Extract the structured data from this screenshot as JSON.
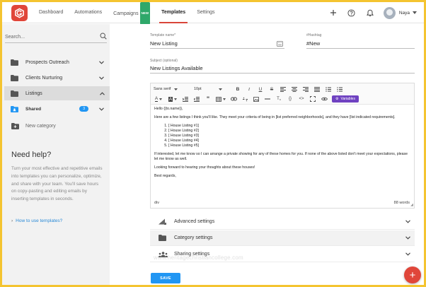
{
  "nav": {
    "items": [
      {
        "label": "Dashboard",
        "active": false
      },
      {
        "label": "Automations",
        "active": false
      },
      {
        "label": "Campaigns",
        "active": false,
        "badge": "NEW"
      },
      {
        "label": "Templates",
        "active": true
      },
      {
        "label": "Settings",
        "active": false
      }
    ],
    "user_name": "Naya",
    "icons": [
      "plus-icon",
      "help-icon",
      "bell-icon",
      "avatar",
      "caret-down-icon"
    ]
  },
  "sidebar": {
    "search_placeholder": "Search...",
    "folders": [
      {
        "label": "Prospects Outreach",
        "active": false
      },
      {
        "label": "Clients Nurturing",
        "active": false
      },
      {
        "label": "Listings",
        "active": true
      },
      {
        "label": "Shared",
        "count": "3",
        "active": false
      }
    ],
    "new_category": "New category",
    "help": {
      "title": "Need help?",
      "text": "Turn your most effective and repetitive emails into templates you can personalize, optimize, and share with your team. You'll save hours on copy-pasting and editing emails by inserting templates in seconds.",
      "link": "How to use templates?"
    }
  },
  "form": {
    "template_name_label": "Template name*",
    "template_name_value": "New Listing",
    "hashtag_label": "#Hashtag",
    "hashtag_value": "#New",
    "subject_label": "Subject (optional)",
    "subject_value": "New Listings Available"
  },
  "editor": {
    "font_family": "Sans serif",
    "font_size": "10pt",
    "variables_label": "Variables",
    "greeting": "Hello {{to.name}},",
    "intro": "Here are a few listings I think you'll like. They meet your criteria of being in [list preferred neighborhoods], and they have [list indicated requirements].",
    "listings": [
      "[ House Listing #1]",
      "[ House Listing #2]",
      "[ House Listing #3]",
      "[ House Listing #4]",
      "[ House Listing #5]"
    ],
    "para2": "If interested, let me know so I can arrange a private showing for any of these homes for you. If none of the above listed don't meet your expectations, please let me know as well.",
    "para3": "Looking forward to hearing your thoughts about these houses!",
    "closing": "Best regards,",
    "status_tag": "div",
    "word_count": "88 words"
  },
  "accordions": [
    {
      "label": "Advanced settings"
    },
    {
      "label": "Category settings"
    },
    {
      "label": "Sharing settings"
    }
  ],
  "save_label": "SAVE",
  "watermark": "www.heritagechristiancollege.com",
  "colors": {
    "brand": "#e0463a",
    "primary": "#2196f3",
    "variables": "#6f42c1",
    "frame": "#f4c430"
  }
}
